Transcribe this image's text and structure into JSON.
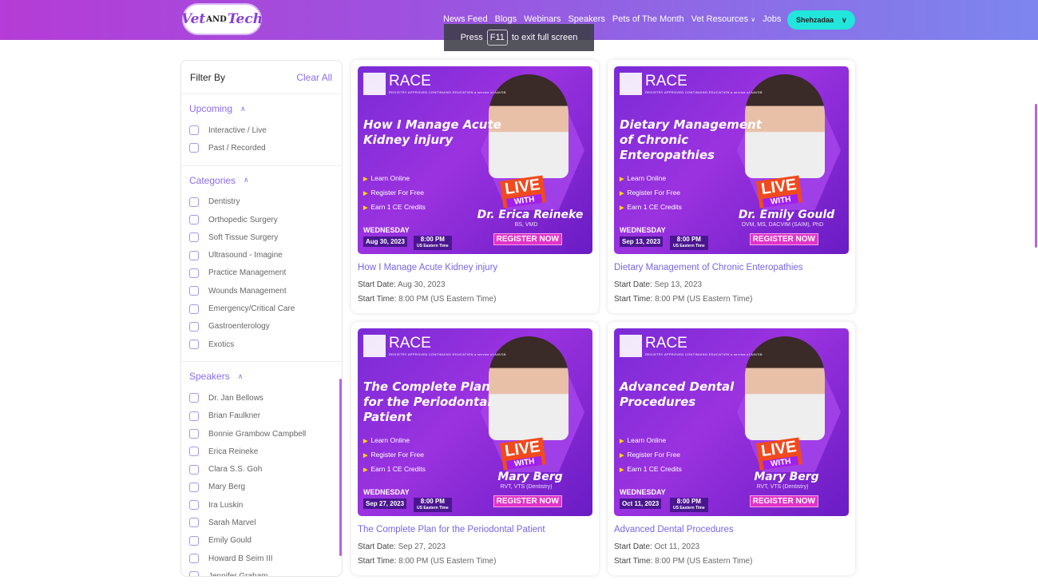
{
  "header": {
    "logo_text": "Vet AND Tech",
    "nav": [
      "News Feed",
      "Blogs",
      "Webinars",
      "Speakers",
      "Pets of The Month",
      "Vet Resources",
      "Jobs"
    ],
    "user_label": "Shehzadaa",
    "fullscreen_notice": {
      "before": "Press",
      "key": "F11",
      "after": "to exit full screen"
    }
  },
  "sidebar": {
    "title": "Filter By",
    "clear_all": "Clear All",
    "sections": [
      {
        "title": "Upcoming",
        "options": [
          "Interactive / Live",
          "Past / Recorded"
        ]
      },
      {
        "title": "Categories",
        "options": [
          "Dentistry",
          "Orthopedic Surgery",
          "Soft Tissue Surgery",
          "Ultrasound - Imagine",
          "Practice Management",
          "Wounds Management",
          "Emergency/Critical Care",
          "Gastroenterology",
          "Exotics"
        ]
      },
      {
        "title": "Speakers",
        "options": [
          "Dr. Jan Bellows",
          "Brian Faulkner",
          "Bonnie Grambow Campbell",
          "Erica Reineke",
          "Clara S.S. Goh",
          "Mary Berg",
          "Ira Luskin",
          "Sarah Marvel",
          "Emily Gould",
          "Howard B Seim III",
          "Jennifer Graham"
        ]
      }
    ]
  },
  "webinars": [
    {
      "banner": {
        "race": "RACE",
        "race_sub": "REGISTRY APPROVED CONTINUING EDUCATION a service of AAVSB",
        "title": "How I Manage Acute Kidney injury",
        "bullets": [
          "Learn Online",
          "Register For Free",
          "Earn 1 CE Credits"
        ],
        "live": "LIVE",
        "with": "WITH",
        "speaker": "Dr. Erica Reineke",
        "credentials": "BS, VMD",
        "register": "REGISTER NOW",
        "day": "WEDNESDAY",
        "date": "Aug 30, 2023",
        "time": "8:00 PM",
        "tz": "US Eastern Time"
      },
      "title": "How I Manage Acute Kidney injury",
      "start_date_label": "Start Date:",
      "start_date": "Aug 30, 2023",
      "start_time_label": "Start Time:",
      "start_time": "8:00 PM (US Eastern Time)"
    },
    {
      "banner": {
        "race": "RACE",
        "race_sub": "REGISTRY APPROVED CONTINUING EDUCATION a service of AAVSB",
        "title": "Dietary Management of Chronic Enteropathies",
        "bullets": [
          "Learn Online",
          "Register For Free",
          "Earn 1 CE Credits"
        ],
        "live": "LIVE",
        "with": "WITH",
        "speaker": "Dr. Emily Gould",
        "credentials": "DVM, MS, DACVIM (SAIM), PhD",
        "register": "REGISTER NOW",
        "day": "WEDNESDAY",
        "date": "Sep 13, 2023",
        "time": "8:00 PM",
        "tz": "US Eastern Time"
      },
      "title": "Dietary Management of Chronic Enteropathies",
      "start_date_label": "Start Date:",
      "start_date": "Sep 13, 2023",
      "start_time_label": "Start Time:",
      "start_time": "8:00 PM (US Eastern Time)"
    },
    {
      "banner": {
        "race": "RACE",
        "race_sub": "REGISTRY APPROVED CONTINUING EDUCATION a service of AAVSB",
        "title": "The Complete Plan for the Periodontal Patient",
        "bullets": [
          "Learn Online",
          "Register For Free",
          "Earn 1 CE Credits"
        ],
        "live": "LIVE",
        "with": "WITH",
        "speaker": "Mary Berg",
        "credentials": "RVT, VTS (Dentistry)",
        "register": "REGISTER NOW",
        "day": "WEDNESDAY",
        "date": "Sep 27, 2023",
        "time": "8:00 PM",
        "tz": "US Eastern Time"
      },
      "title": "The Complete Plan for the Periodontal Patient",
      "start_date_label": "Start Date:",
      "start_date": "Sep 27, 2023",
      "start_time_label": "Start Time:",
      "start_time": "8:00 PM (US Eastern Time)"
    },
    {
      "banner": {
        "race": "RACE",
        "race_sub": "REGISTRY APPROVED CONTINUING EDUCATION a service of AAVSB",
        "title": "Advanced Dental Procedures",
        "bullets": [
          "Learn Online",
          "Register For Free",
          "Earn 1 CE Credits"
        ],
        "live": "LIVE",
        "with": "WITH",
        "speaker": "Mary Berg",
        "credentials": "RVT, VTS (Dentistry)",
        "register": "REGISTER NOW",
        "day": "WEDNESDAY",
        "date": "Oct 11, 2023",
        "time": "8:00 PM",
        "tz": "US Eastern Time"
      },
      "title": "Advanced Dental Procedures",
      "start_date_label": "Start Date:",
      "start_date": "Oct 11, 2023",
      "start_time_label": "Start Time:",
      "start_time": "8:00 PM (US Eastern Time)"
    }
  ],
  "colors": {
    "accent": "#8a6cf0",
    "user_button": "#22e6dc",
    "header_start": "#b53cd6",
    "header_end": "#7d86ee"
  }
}
